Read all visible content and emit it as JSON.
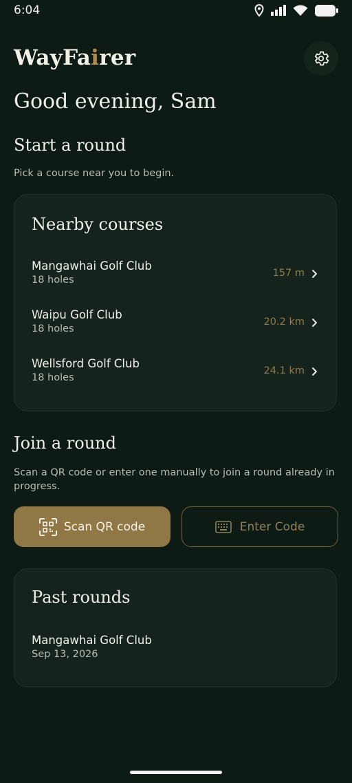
{
  "status_bar": {
    "time": "6:04",
    "icons": [
      "location-icon",
      "signal-icon",
      "wifi-icon",
      "battery-icon"
    ]
  },
  "header": {
    "logo_prefix": "WayFa",
    "logo_accent": "i",
    "logo_suffix": "rer",
    "settings_icon": "gear-icon"
  },
  "greeting": "Good evening, Sam",
  "start_round": {
    "heading": "Start a round",
    "subtitle": "Pick a course near you to begin."
  },
  "nearby": {
    "title": "Nearby courses",
    "courses": [
      {
        "name": "Mangawhai Golf Club",
        "holes": "18 holes",
        "distance": "157 m"
      },
      {
        "name": "Waipu Golf Club",
        "holes": "18 holes",
        "distance": "20.2 km"
      },
      {
        "name": "Wellsford Golf Club",
        "holes": "18 holes",
        "distance": "24.1 km"
      }
    ]
  },
  "join_round": {
    "heading": "Join a round",
    "subtitle": "Scan a QR code or enter one manually to join a round already in progress.",
    "scan_label": "Scan QR code",
    "code_label": "Enter Code"
  },
  "past_rounds": {
    "title": "Past rounds",
    "items": [
      {
        "name": "Mangawhai Golf Club",
        "date": "Sep 13, 2026"
      }
    ]
  },
  "colors": {
    "background": "#0d1b14",
    "card": "#15231c",
    "accent_gold": "#8f7845",
    "muted_gold": "#8f7d4f"
  }
}
